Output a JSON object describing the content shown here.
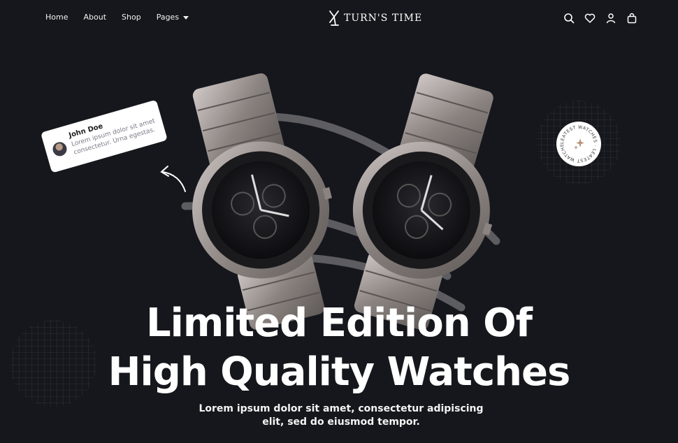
{
  "nav": {
    "items": [
      {
        "label": "Home"
      },
      {
        "label": "About"
      },
      {
        "label": "Shop"
      },
      {
        "label": "Pages"
      }
    ]
  },
  "brand": {
    "name": "TURN'S TIME"
  },
  "header_icons": [
    "search-icon",
    "heart-icon",
    "user-icon",
    "bag-icon"
  ],
  "review": {
    "name": "John Doe",
    "text": "Lorem ipsum dolor sit amet consectetur. Urna egestas."
  },
  "badge": {
    "text": "LEATEST WATCHES · LEATEST WATCHES ·"
  },
  "hero": {
    "title_line1": "Limited Edition Of",
    "title_line2": "High Quality Watches",
    "subtitle_line1": "Lorem ipsum dolor sit amet, consectetur adipiscing",
    "subtitle_line2": "elit, sed do eiusmod tempor."
  },
  "colors": {
    "background": "#16171c",
    "text": "#ffffff",
    "accent": "#b8927a"
  }
}
